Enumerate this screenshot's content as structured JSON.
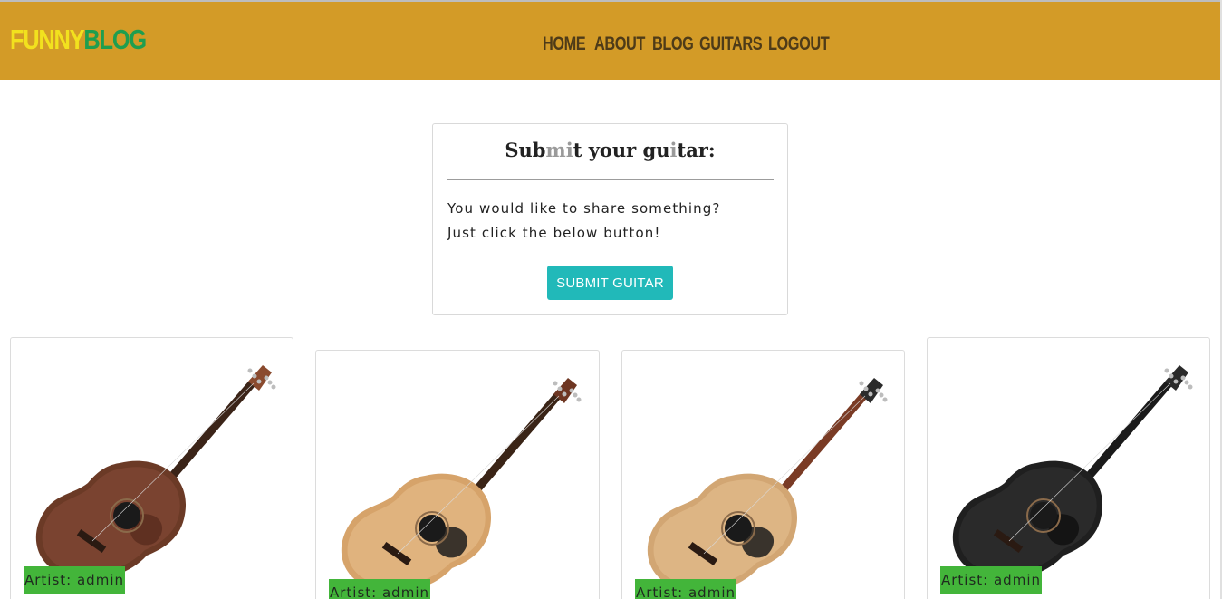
{
  "header": {
    "logo_part1": "FUNNY",
    "logo_part2": "BLOG",
    "nav": [
      "HOME",
      "ABOUT",
      "BLOG",
      "GUITARS",
      "LOGOUT"
    ]
  },
  "submit": {
    "title_parts": [
      "Sub",
      "mi",
      "t your gu",
      "i",
      "tar:"
    ],
    "line1": "You would like to share something?",
    "line2": "Just click the below button!",
    "button": "SUBMIT GUITAR"
  },
  "guitars": [
    {
      "artist": "Artist: admin",
      "body_color": "#6b3a26",
      "soundboard": "#7a4330",
      "neck": "#3b2418",
      "head": "#8a4a2e",
      "guard": "#5b2d1e"
    },
    {
      "artist": "Artist: admin",
      "body_color": "#d6a36a",
      "soundboard": "#e0b37e",
      "neck": "#3a2416",
      "head": "#6e3622",
      "guard": "#1c1c1c"
    },
    {
      "artist": "Artist: admin",
      "body_color": "#d2a673",
      "soundboard": "#ddb584",
      "neck": "#7a3b25",
      "head": "#2b2b2b",
      "guard": "#1c1c1c"
    },
    {
      "artist": "Artist: admin",
      "body_color": "#1f1f1f",
      "soundboard": "#2a2a2a",
      "neck": "#1a1a1a",
      "head": "#2a2a2a",
      "guard": "#111111"
    }
  ]
}
